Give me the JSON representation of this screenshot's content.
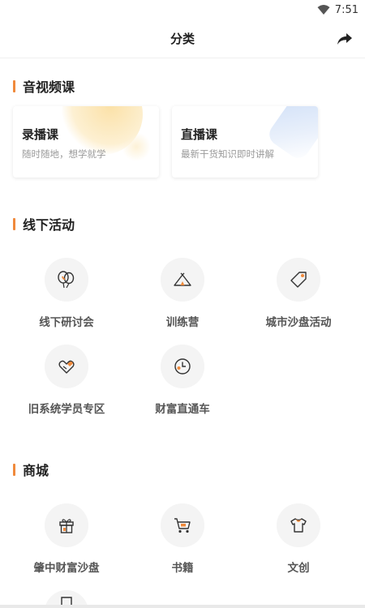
{
  "status": {
    "time": "7:51"
  },
  "header": {
    "title": "分类"
  },
  "sections": {
    "video": {
      "title": "音视频课"
    },
    "offline": {
      "title": "线下活动"
    },
    "mall": {
      "title": "商城"
    }
  },
  "courses": [
    {
      "name": "录播课",
      "desc": "随时随地，想学就学"
    },
    {
      "name": "直播课",
      "desc": "最新干货知识即时讲解"
    }
  ],
  "offline_items": [
    {
      "label": "线下研讨会",
      "icon": "balloons-icon"
    },
    {
      "label": "训练营",
      "icon": "tent-icon"
    },
    {
      "label": "城市沙盘活动",
      "icon": "tag-icon"
    },
    {
      "label": "旧系统学员专区",
      "icon": "heart-hand-icon"
    },
    {
      "label": "财富直通车",
      "icon": "clock-icon"
    }
  ],
  "mall_items": [
    {
      "label": "肇中财富沙盘",
      "icon": "gift-icon"
    },
    {
      "label": "书籍",
      "icon": "cart-icon"
    },
    {
      "label": "文创",
      "icon": "tshirt-icon"
    }
  ],
  "colors": {
    "accent": "#f08a3c",
    "icon_stroke": "#333333"
  }
}
